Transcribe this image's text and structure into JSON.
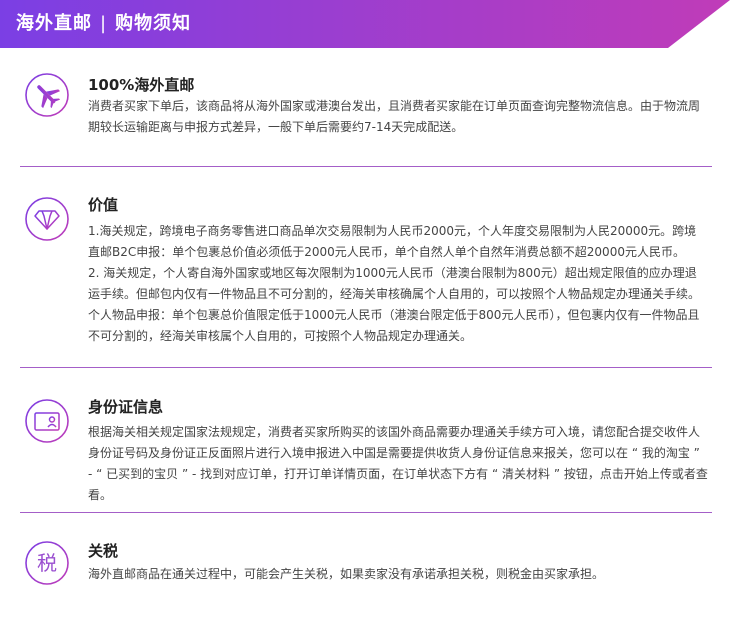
{
  "banner": {
    "title": "海外直邮",
    "separator": "|",
    "subtitle": "购物须知",
    "gradient_start": "#7b3fe4",
    "gradient_end": "#c03cb8"
  },
  "accent_color": "#a45ec8",
  "sections": [
    {
      "icon": "airplane-icon",
      "title": "100%海外直邮",
      "paragraphs": [
        "消费者买家下单后，该商品将从海外国家或港澳台发出，且消费者买家能在订单页面查询完整物流信息。由于物流周期较长运输距离与申报方式差异，一般下单后需要约7-14天完成配送。"
      ]
    },
    {
      "icon": "diamond-icon",
      "title": "价值",
      "paragraphs": [
        "1.海关规定，跨境电子商务零售进口商品单次交易限制为人民币2000元，个人年度交易限制为人民20000元。跨境直邮B2C申报：单个包裹总价值必须低于2000元人民币，单个自然人单个自然年消费总额不超20000元人民币。",
        "2. 海关规定，个人寄自海外国家或地区每次限制为1000元人民币（港澳台限制为800元）超出规定限值的应办理退运手续。但邮包内仅有一件物品且不可分割的，经海关审核确属个人自用的，可以按照个人物品规定办理通关手续。个人物品申报：单个包裹总价值限定低于1000元人民币（港澳台限定低于800元人民币），但包裹内仅有一件物品且不可分割的，经海关审核属个人自用的，可按照个人物品规定办理通关。"
      ]
    },
    {
      "icon": "id-card-icon",
      "title": "身份证信息",
      "paragraphs": [
        "根据海关相关规定国家法规规定，消费者买家所购买的该国外商品需要办理通关手续方可入境，请您配合提交收件人身份证号码及身份证正反面照片进行入境申报进入中国是需要提供收货人身份证信息来报关，您可以在 “ 我的淘宝 ” - “ 已买到的宝贝 ” - 找到对应订单，打开订单详情页面，在订单状态下方有 “ 清关材料 ” 按钮，点击开始上传或者查看。"
      ]
    },
    {
      "icon": "tax-icon",
      "icon_text": "税",
      "title": "关税",
      "paragraphs": [
        "海外直邮商品在通关过程中，可能会产生关税，如果卖家没有承诺承担关税，则税金由买家承担。"
      ]
    }
  ]
}
